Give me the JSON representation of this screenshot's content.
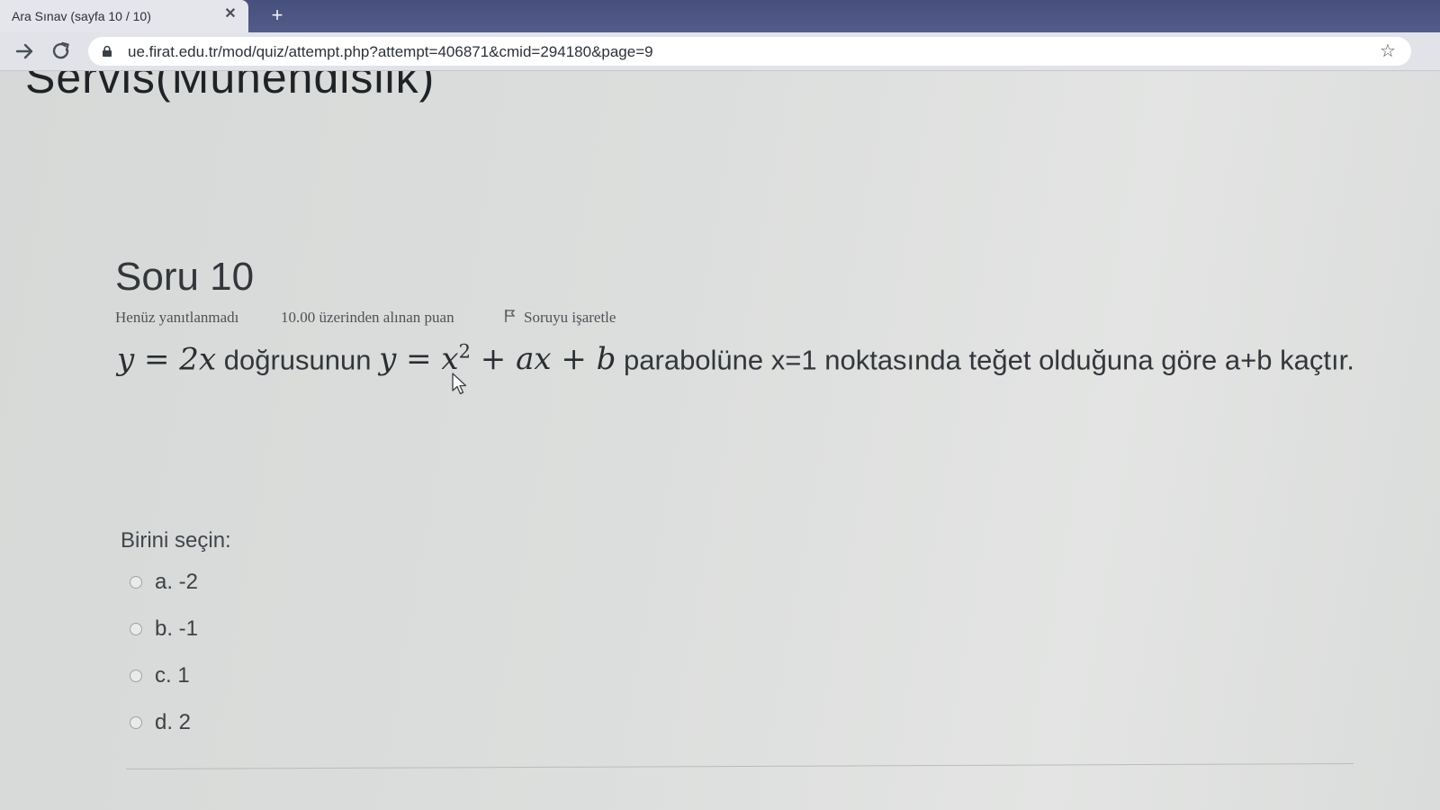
{
  "browser": {
    "tab_title": "Ara Sınav (sayfa 10 / 10)",
    "tab_close_glyph": "✕",
    "new_tab_glyph": "+",
    "url": "ue.firat.edu.tr/mod/quiz/attempt.php?attempt=406871&cmid=294180&page=9",
    "icons": [
      "back-icon",
      "reload-icon",
      "lock-icon",
      "star-icon",
      "extension-icon",
      "close-icon",
      "plus-icon"
    ]
  },
  "page": {
    "course_title": "Servis(Mühendislik)",
    "question": {
      "number_label": "Soru 10",
      "status": "Henüz yanıtlanmadı",
      "grade": "10.00 üzerinden alınan puan",
      "flag_label": "Soruyu işaretle",
      "text": {
        "math1": "y = 2x",
        "part1": " doğrusunun ",
        "math2_base": "y = x",
        "math2_exp": "2",
        "math2_rest": " + ax + b",
        "part2": " parabolüne x=1 noktasında teğet olduğuna göre a+b kaçtır."
      }
    },
    "choose_label": "Birini seçin:",
    "answers": [
      {
        "label": "a. -2",
        "selected": false
      },
      {
        "label": "b. -1",
        "selected": false
      },
      {
        "label": "c. 1",
        "selected": false
      },
      {
        "label": "d. 2",
        "selected": false
      }
    ]
  },
  "colors": {
    "tabbar": "#4b5482",
    "page_background": "#d9dbda",
    "text": "#33373b"
  }
}
